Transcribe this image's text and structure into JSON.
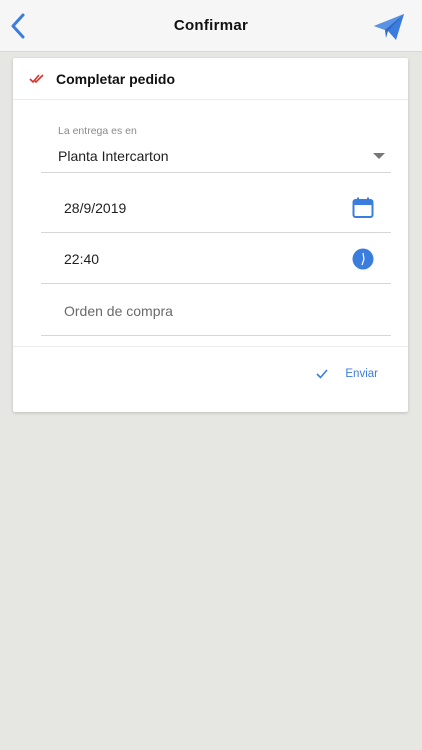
{
  "navbar": {
    "title": "Confirmar",
    "back_icon": "chevron-left-icon",
    "send_icon": "paper-plane-icon"
  },
  "card": {
    "title": "Completar pedido",
    "title_icon": "double-check-icon",
    "delivery": {
      "label": "La entrega es en",
      "value": "Planta Intercarton"
    },
    "date": {
      "value": "28/9/2019",
      "icon": "calendar-icon"
    },
    "time": {
      "value": "22:40",
      "icon": "clock-icon"
    },
    "purchase_order": {
      "placeholder": "Orden de compra"
    },
    "send_button": {
      "label": "Enviar",
      "icon": "check-icon"
    }
  },
  "colors": {
    "accent": "#3b7ddd",
    "title_check": "#d9322e",
    "background": "#e6e6e2",
    "navbar": "#f6f6f6"
  }
}
